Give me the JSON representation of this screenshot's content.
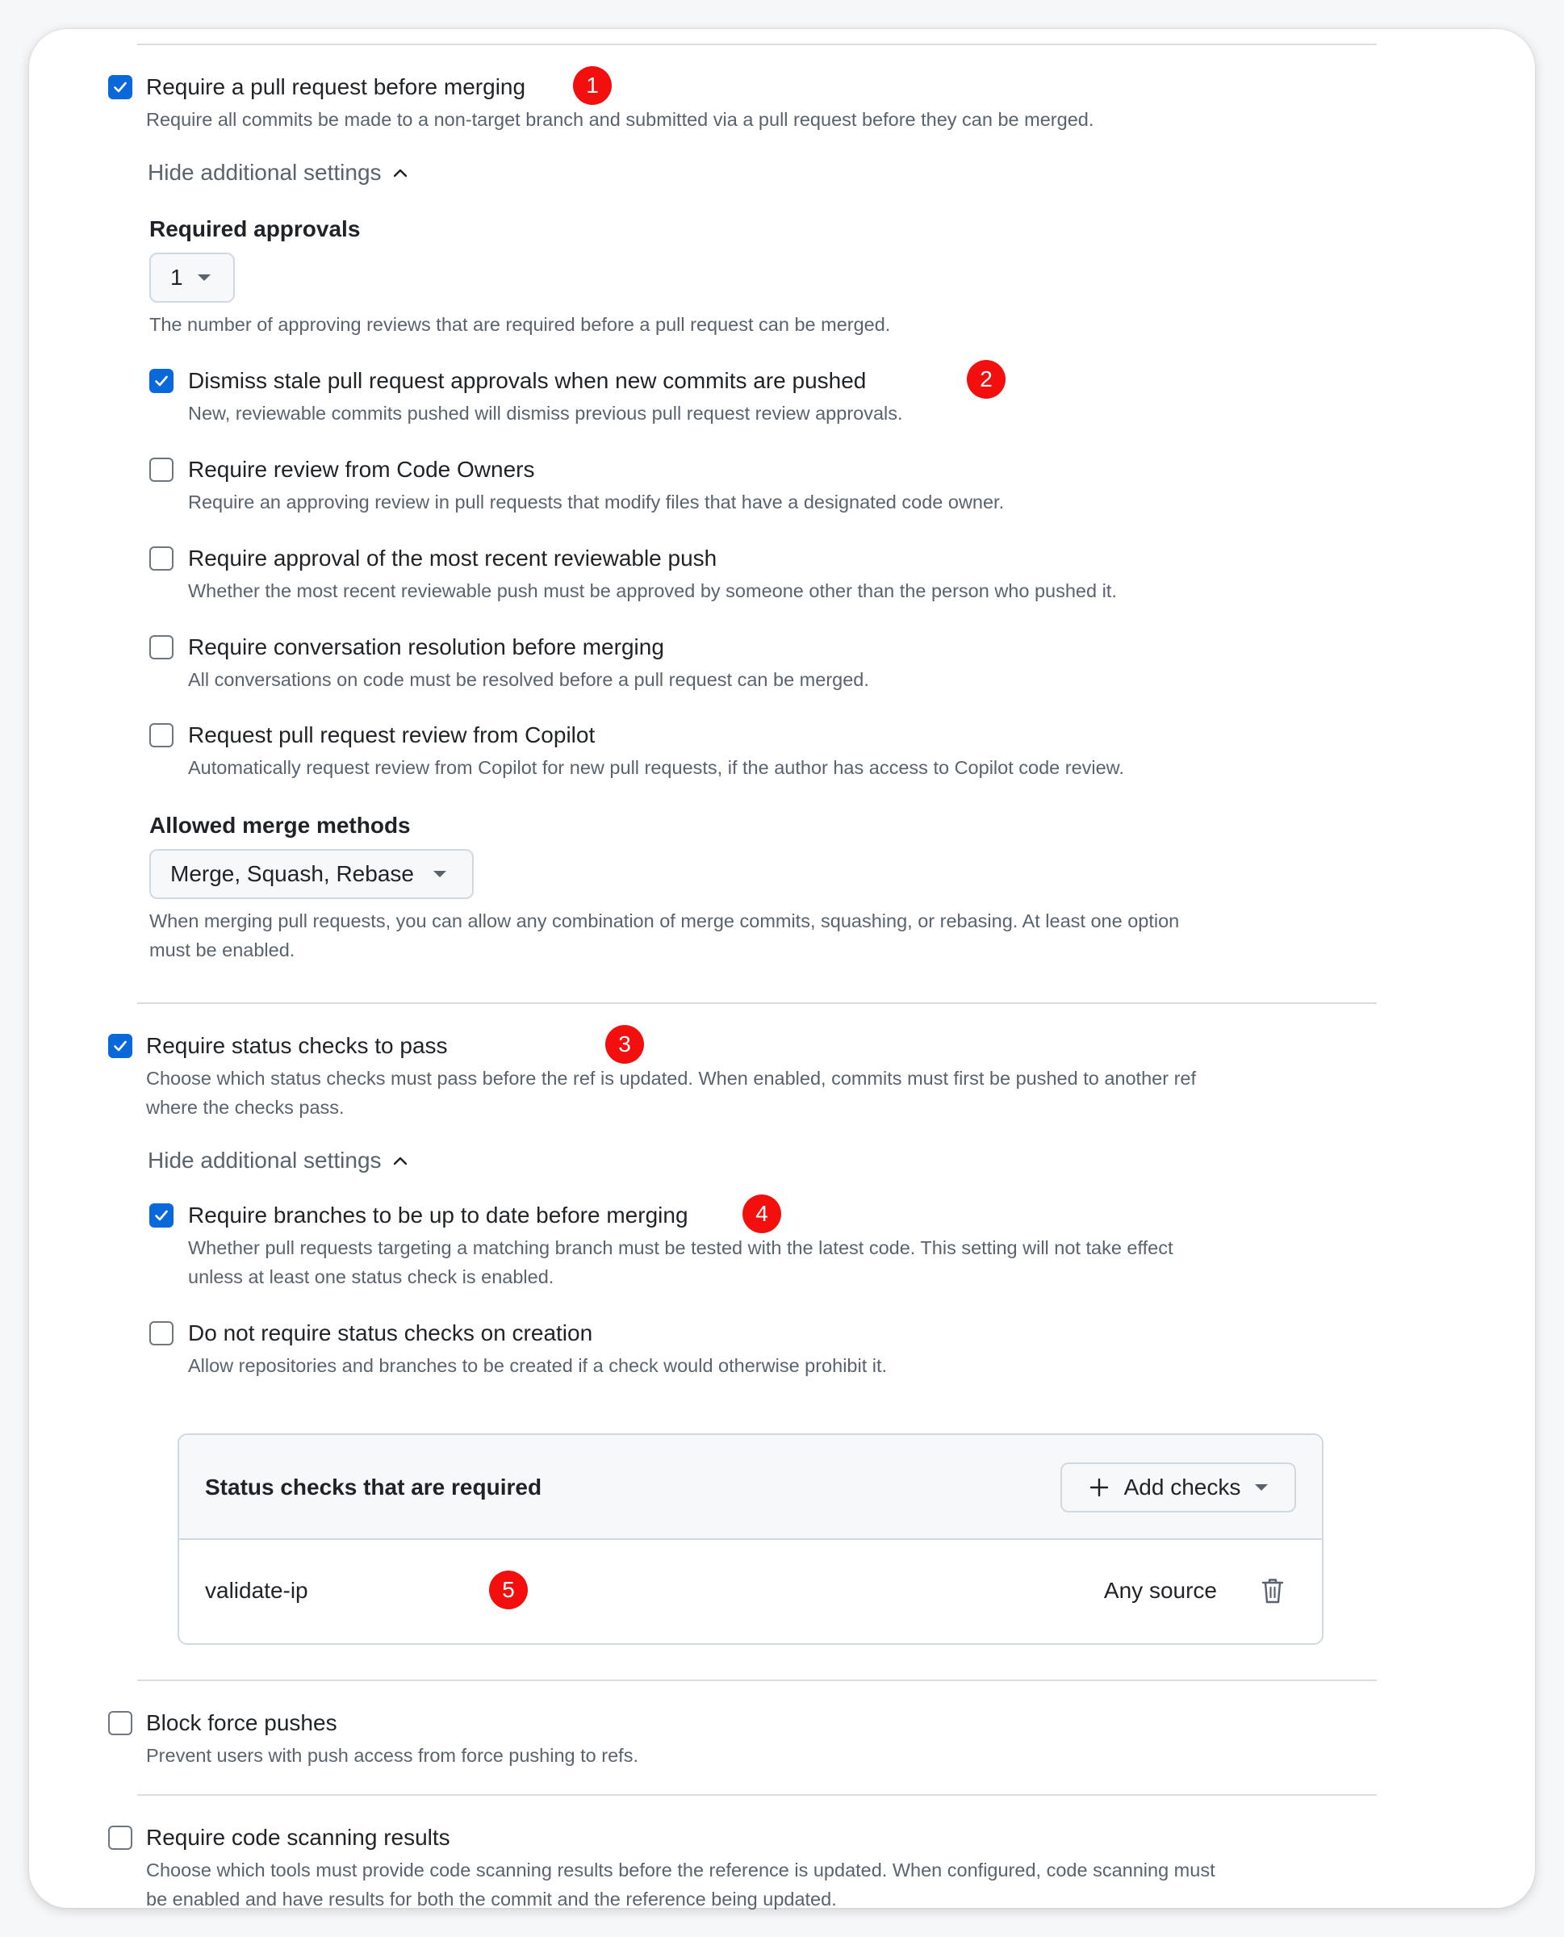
{
  "rules": {
    "pull_request": {
      "title": "Require a pull request before merging",
      "description": "Require all commits be made to a non-target branch and submitted via a pull request before they can be merged.",
      "checked": true,
      "badge": "1",
      "hide_settings": "Hide additional settings",
      "required_approvals": {
        "label": "Required approvals",
        "value": "1",
        "description": "The number of approving reviews that are required before a pull request can be merged."
      },
      "options": [
        {
          "title": "Dismiss stale pull request approvals when new commits are pushed",
          "description": "New, reviewable commits pushed will dismiss previous pull request review approvals.",
          "checked": true,
          "badge": "2"
        },
        {
          "title": "Require review from Code Owners",
          "description": "Require an approving review in pull requests that modify files that have a designated code owner.",
          "checked": false
        },
        {
          "title": "Require approval of the most recent reviewable push",
          "description": "Whether the most recent reviewable push must be approved by someone other than the person who pushed it.",
          "checked": false
        },
        {
          "title": "Require conversation resolution before merging",
          "description": "All conversations on code must be resolved before a pull request can be merged.",
          "checked": false
        },
        {
          "title": "Request pull request review from Copilot",
          "description": "Automatically request review from Copilot for new pull requests, if the author has access to Copilot code review.",
          "checked": false
        }
      ],
      "merge_methods": {
        "label": "Allowed merge methods",
        "value": "Merge, Squash, Rebase",
        "description_line1": "When merging pull requests, you can allow any combination of merge commits, squashing, or rebasing. At least one option",
        "description_line2": "must be enabled."
      }
    },
    "status_checks": {
      "title": "Require status checks to pass",
      "description_line1": "Choose which status checks must pass before the ref is updated. When enabled, commits must first be pushed to another ref",
      "description_line2": "where the checks pass.",
      "checked": true,
      "badge": "3",
      "hide_settings": "Hide additional settings",
      "options": [
        {
          "title": "Require branches to be up to date before merging",
          "description_line1": "Whether pull requests targeting a matching branch must be tested with the latest code. This setting will not take effect",
          "description_line2": "unless at least one status check is enabled.",
          "checked": true,
          "badge": "4"
        },
        {
          "title": "Do not require status checks on creation",
          "description": "Allow repositories and branches to be created if a check would otherwise prohibit it.",
          "checked": false
        }
      ],
      "required_box": {
        "title": "Status checks that are required",
        "add_label": "Add checks",
        "rows": [
          {
            "name": "validate-ip",
            "source": "Any source",
            "badge": "5"
          }
        ]
      }
    },
    "force_push": {
      "title": "Block force pushes",
      "description": "Prevent users with push access from force pushing to refs.",
      "checked": false
    },
    "code_scanning": {
      "title": "Require code scanning results",
      "description_line1": "Choose which tools must provide code scanning results before the reference is updated. When configured, code scanning must",
      "description_line2": "be enabled and have results for both the commit and the reference being updated.",
      "checked": false
    }
  },
  "colors": {
    "checkbox_checked": "#0969da",
    "badge": "#f40f0f",
    "muted_text": "#59636e"
  }
}
